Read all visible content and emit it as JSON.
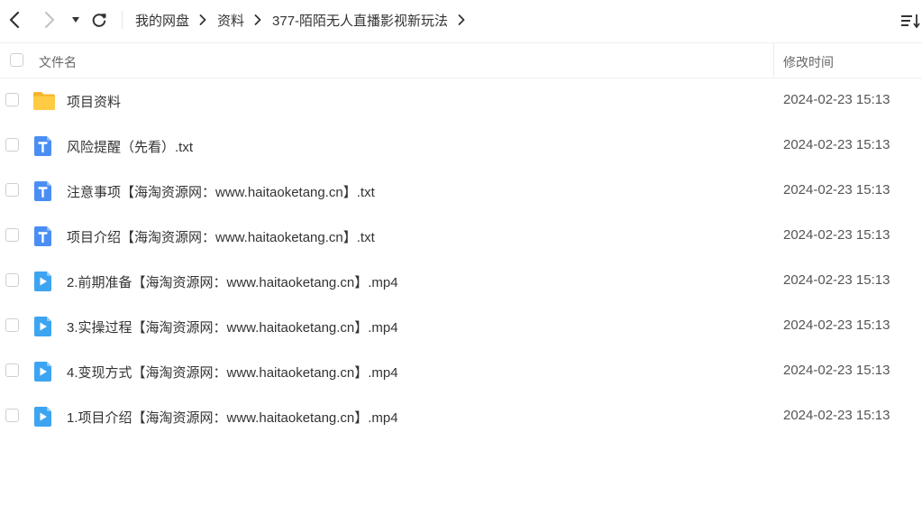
{
  "nav": {
    "back_icon": "chevron-left-icon",
    "forward_icon": "chevron-right-icon",
    "dropdown_icon": "caret-down-icon",
    "refresh_icon": "refresh-icon",
    "sort_icon": "sort-icon"
  },
  "breadcrumb": [
    "我的网盘",
    "资料",
    "377-陌陌无人直播影视新玩法"
  ],
  "header": {
    "name_label": "文件名",
    "time_label": "修改时间"
  },
  "files": [
    {
      "name": "项目资料",
      "time": "2024-02-23 15:13",
      "type": "folder"
    },
    {
      "name": "风险提醒（先看）.txt",
      "time": "2024-02-23 15:13",
      "type": "txt"
    },
    {
      "name": "注意事项【海淘资源网：www.haitaoketang.cn】.txt",
      "time": "2024-02-23 15:13",
      "type": "txt"
    },
    {
      "name": "项目介绍【海淘资源网：www.haitaoketang.cn】.txt",
      "time": "2024-02-23 15:13",
      "type": "txt"
    },
    {
      "name": "2.前期准备【海淘资源网：www.haitaoketang.cn】.mp4",
      "time": "2024-02-23 15:13",
      "type": "mp4"
    },
    {
      "name": "3.实操过程【海淘资源网：www.haitaoketang.cn】.mp4",
      "time": "2024-02-23 15:13",
      "type": "mp4"
    },
    {
      "name": "4.变现方式【海淘资源网：www.haitaoketang.cn】.mp4",
      "time": "2024-02-23 15:13",
      "type": "mp4"
    },
    {
      "name": "1.项目介绍【海淘资源网：www.haitaoketang.cn】.mp4",
      "time": "2024-02-23 15:13",
      "type": "mp4"
    }
  ],
  "colors": {
    "folder": "#FFC83D",
    "txt": "#4A8EF3",
    "mp4": "#3DA4F2",
    "text": "#333333",
    "muted": "#666666"
  }
}
